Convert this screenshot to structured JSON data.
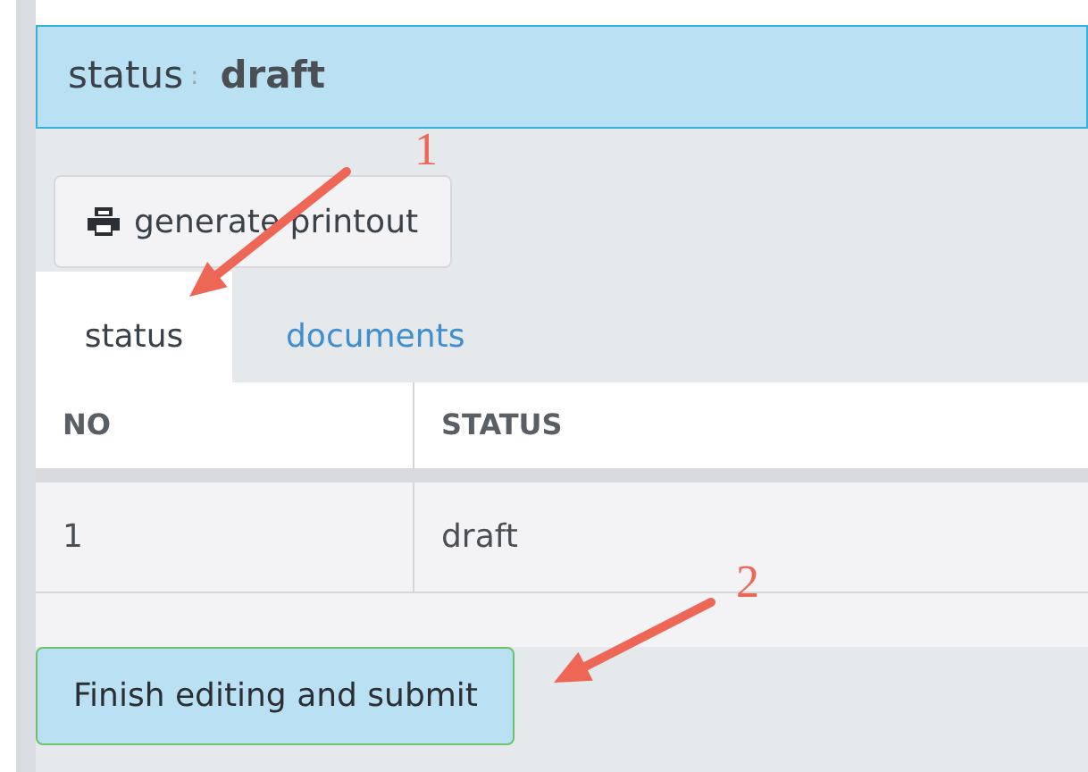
{
  "status_banner": {
    "label": "status",
    "separator": ":",
    "value": "draft"
  },
  "print_button": {
    "label": "generate printout"
  },
  "tabs": [
    {
      "label": "status",
      "selected": true
    },
    {
      "label": "documents",
      "selected": false
    }
  ],
  "table": {
    "columns": [
      "NO",
      "STATUS"
    ],
    "rows": [
      [
        "1",
        "draft"
      ]
    ]
  },
  "submit_button": {
    "label": "Finish editing and submit"
  },
  "annotations": [
    {
      "number": "1"
    },
    {
      "number": "2"
    }
  ]
}
